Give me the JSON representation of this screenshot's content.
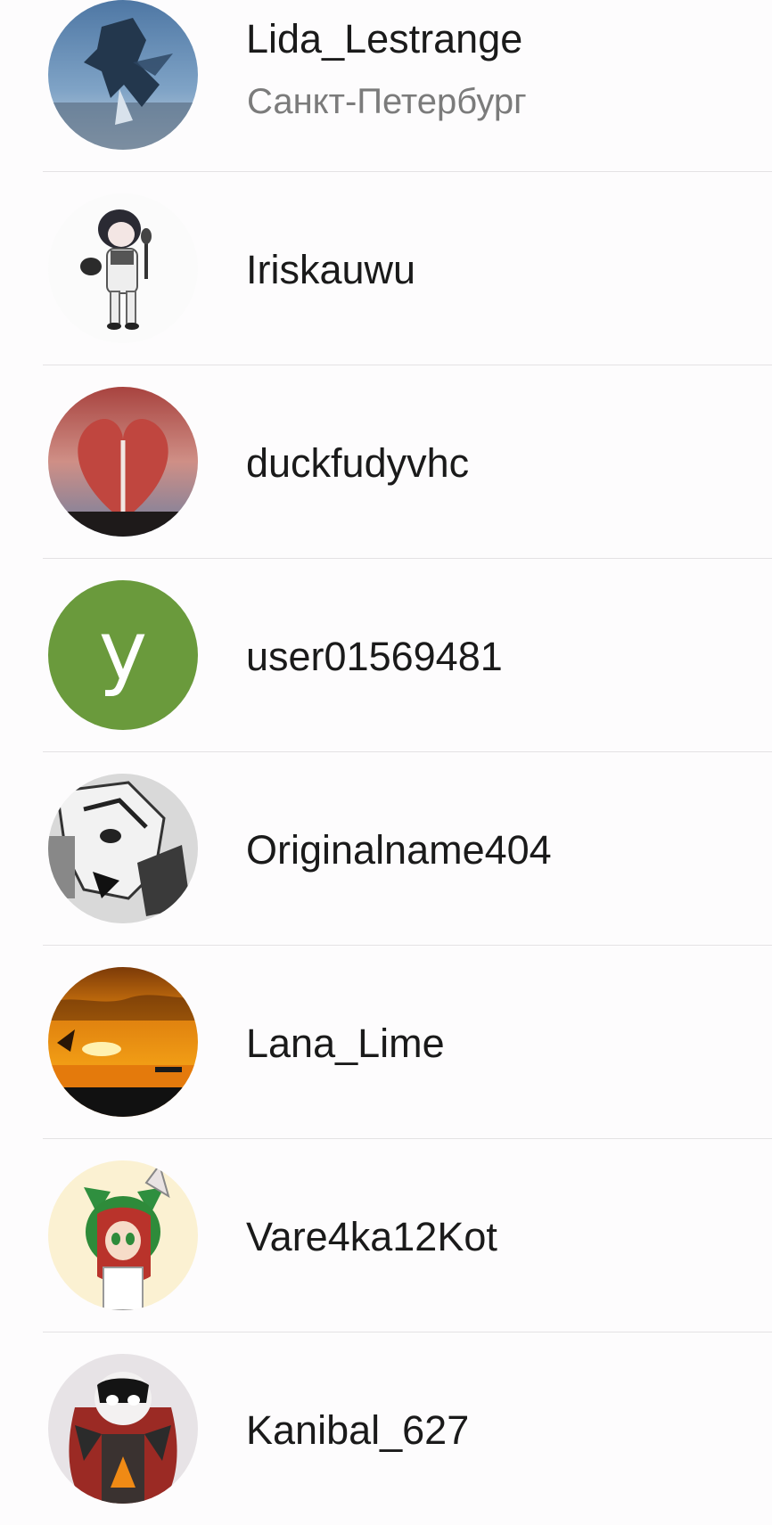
{
  "contacts": [
    {
      "name": "Lida_Lestrange",
      "subtitle": "Санкт-Петербург",
      "avatar": "dragon-sky-photo"
    },
    {
      "name": "Iriskauwu",
      "avatar": "chibi-character-drawing"
    },
    {
      "name": "duckfudyvhc",
      "avatar": "book-heart-photo"
    },
    {
      "name": "user01569481",
      "avatar": "letter-avatar",
      "avatar_letter": "y",
      "avatar_color": "#6a9a3c"
    },
    {
      "name": "Originalname404",
      "avatar": "manga-character-drawing"
    },
    {
      "name": "Lana_Lime",
      "avatar": "sunset-sea-photo"
    },
    {
      "name": "Vare4ka12Kot",
      "avatar": "cat-ear-character-drawing"
    },
    {
      "name": "Kanibal_627",
      "avatar": "masked-character-drawing"
    }
  ]
}
